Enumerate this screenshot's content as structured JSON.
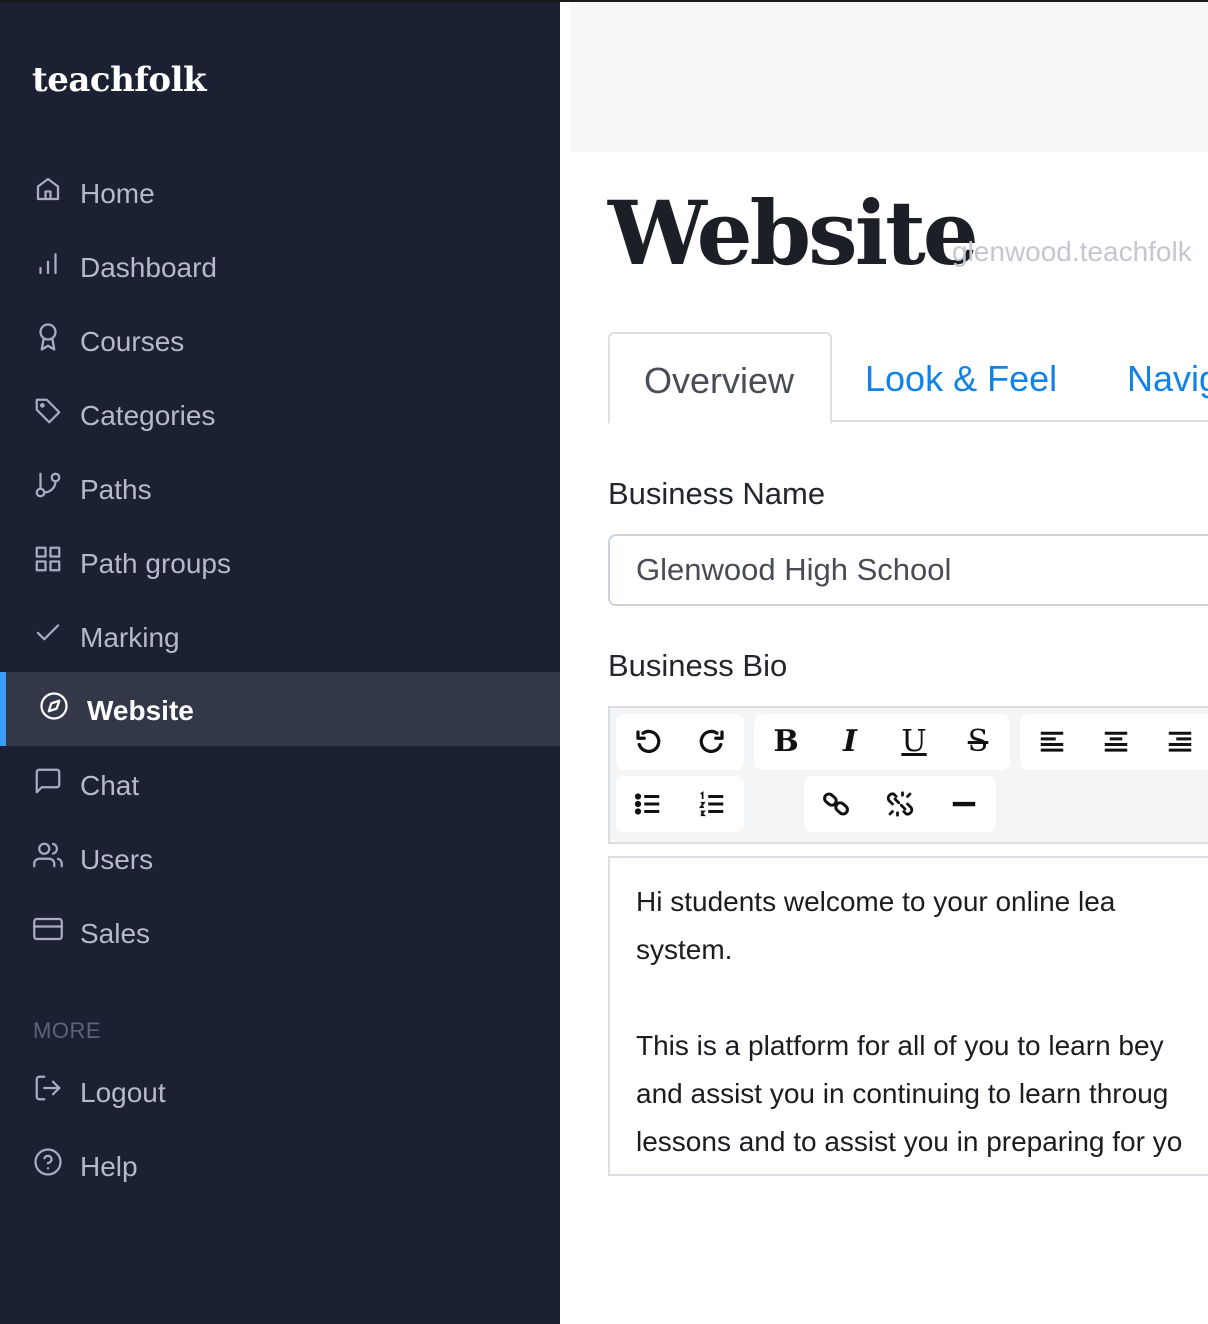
{
  "app": {
    "logo": "teachfolk"
  },
  "sidebar": {
    "items": [
      {
        "label": "Home",
        "icon": "home-icon"
      },
      {
        "label": "Dashboard",
        "icon": "bar-chart-icon"
      },
      {
        "label": "Courses",
        "icon": "award-icon"
      },
      {
        "label": "Categories",
        "icon": "tag-icon"
      },
      {
        "label": "Paths",
        "icon": "git-branch-icon"
      },
      {
        "label": "Path groups",
        "icon": "grid-icon"
      },
      {
        "label": "Marking",
        "icon": "check-icon"
      },
      {
        "label": "Website",
        "icon": "compass-icon",
        "active": true
      },
      {
        "label": "Chat",
        "icon": "message-square-icon"
      },
      {
        "label": "Users",
        "icon": "users-icon"
      },
      {
        "label": "Sales",
        "icon": "credit-card-icon"
      }
    ],
    "more_heading": "MORE",
    "more_items": [
      {
        "label": "Logout",
        "icon": "log-out-icon"
      },
      {
        "label": "Help",
        "icon": "help-circle-icon"
      }
    ]
  },
  "page": {
    "title": "Website",
    "subdomain": "glenwood.teachfolk"
  },
  "tabs": [
    {
      "label": "Overview",
      "active": true
    },
    {
      "label": "Look & Feel"
    },
    {
      "label": "Navig"
    }
  ],
  "form": {
    "business_name_label": "Business Name",
    "business_name_value": "Glenwood High School",
    "business_bio_label": "Business Bio"
  },
  "toolbar": {
    "buttons": [
      "undo",
      "redo",
      "bold",
      "italic",
      "underline",
      "strikethrough",
      "align-left",
      "align-center",
      "align-right",
      "bullet-list",
      "numbered-list",
      "link",
      "unlink",
      "horizontal-rule"
    ],
    "bold_glyph": "B",
    "italic_glyph": "I",
    "underline_glyph": "U",
    "strike_glyph": "S"
  },
  "editor": {
    "line1": "Hi  students  welcome  to  your  online  lea",
    "line2": "system.",
    "line3": "This is a platform for all of you to learn bey",
    "line4": "and assist you in continuing to learn throug",
    "line5": "lessons and to assist you in preparing for yo"
  },
  "colors": {
    "sidebar_bg": "#1c2033",
    "active_bg": "#333849",
    "accent": "#3d9ef7",
    "link": "#1282e6"
  }
}
